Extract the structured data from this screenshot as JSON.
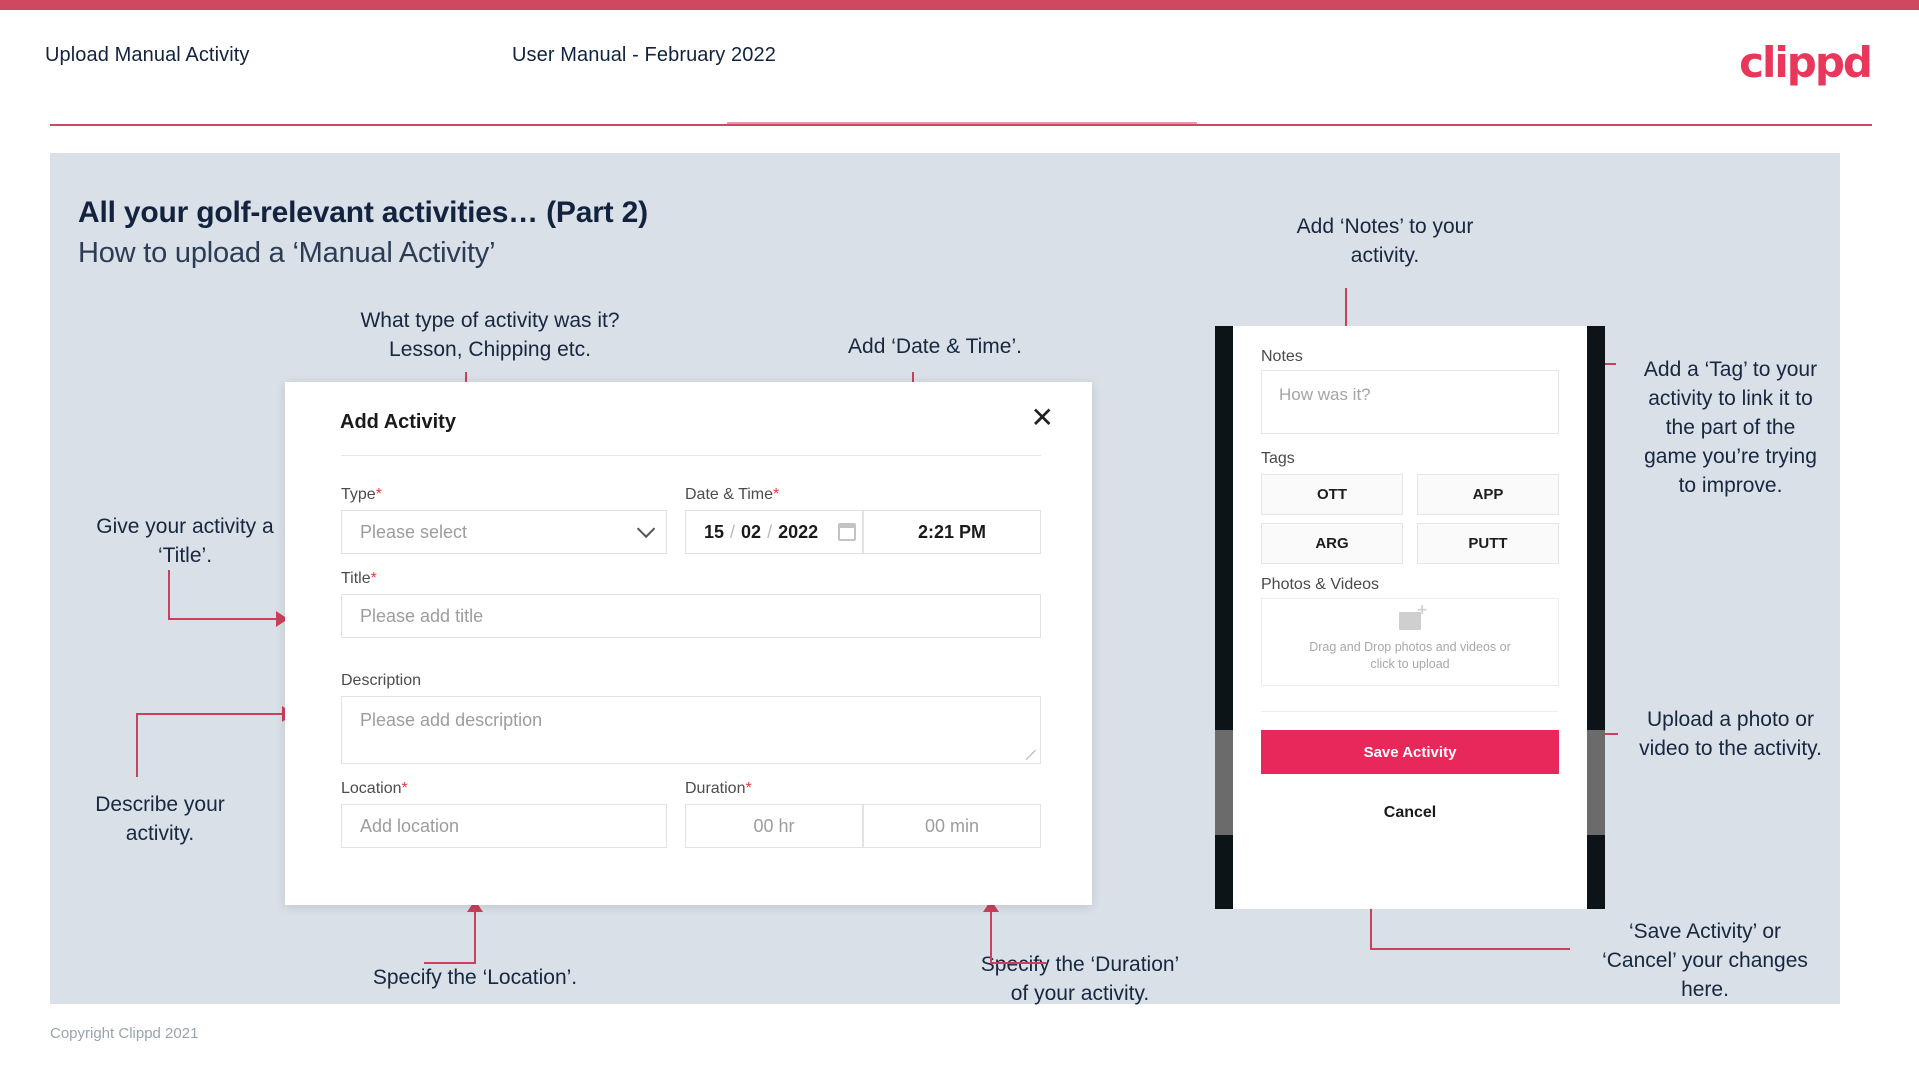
{
  "header": {
    "title": "Upload Manual Activity",
    "subtitle": "User Manual - February 2022",
    "logo": "clippd"
  },
  "slide": {
    "heading": "All your golf-relevant activities… (Part 2)",
    "subheading": "How to upload a ‘Manual Activity’",
    "footer": "Copyright Clippd 2021"
  },
  "annotations": {
    "type": "What type of activity was it?\nLesson, Chipping etc.",
    "datetime": "Add ‘Date & Time’.",
    "title": "Give your activity a\n‘Title’.",
    "description": "Describe your\nactivity.",
    "location": "Specify the ‘Location’.",
    "duration": "Specify the ‘Duration’\nof your activity.",
    "notes": "Add ‘Notes’ to your\nactivity.",
    "tags": "Add a ‘Tag’ to your\nactivity to link it to\nthe part of the\ngame you’re trying\nto improve.",
    "upload": "Upload a photo or\nvideo to the activity.",
    "save_cancel": "‘Save Activity’ or\n‘Cancel’ your changes\nhere."
  },
  "dialog": {
    "title": "Add Activity",
    "close_icon": "close-icon",
    "fields": {
      "type": {
        "label": "Type",
        "required": "*",
        "placeholder": "Please select"
      },
      "datetime": {
        "label": "Date & Time",
        "required": "*",
        "day": "15",
        "month": "02",
        "year": "2022",
        "sep": "/",
        "time": "2:21 PM"
      },
      "title": {
        "label": "Title",
        "required": "*",
        "placeholder": "Please add title"
      },
      "description": {
        "label": "Description",
        "placeholder": "Please add description"
      },
      "location": {
        "label": "Location",
        "required": "*",
        "placeholder": "Add location"
      },
      "duration": {
        "label": "Duration",
        "required": "*",
        "hours": "00 hr",
        "minutes": "00 min"
      }
    }
  },
  "phone": {
    "notes": {
      "label": "Notes",
      "placeholder": "How was it?"
    },
    "tags": {
      "label": "Tags",
      "items": [
        "OTT",
        "APP",
        "ARG",
        "PUTT"
      ]
    },
    "photos": {
      "label": "Photos & Videos",
      "upload_line1": "Drag and Drop photos and videos or",
      "upload_line2": "click to upload"
    },
    "save_label": "Save Activity",
    "cancel_label": "Cancel"
  },
  "colors": {
    "brand_pink": "#e8275a",
    "accent_line": "#c9415c",
    "slide_bg": "#d9e0e8",
    "navy_text": "#13233f"
  }
}
